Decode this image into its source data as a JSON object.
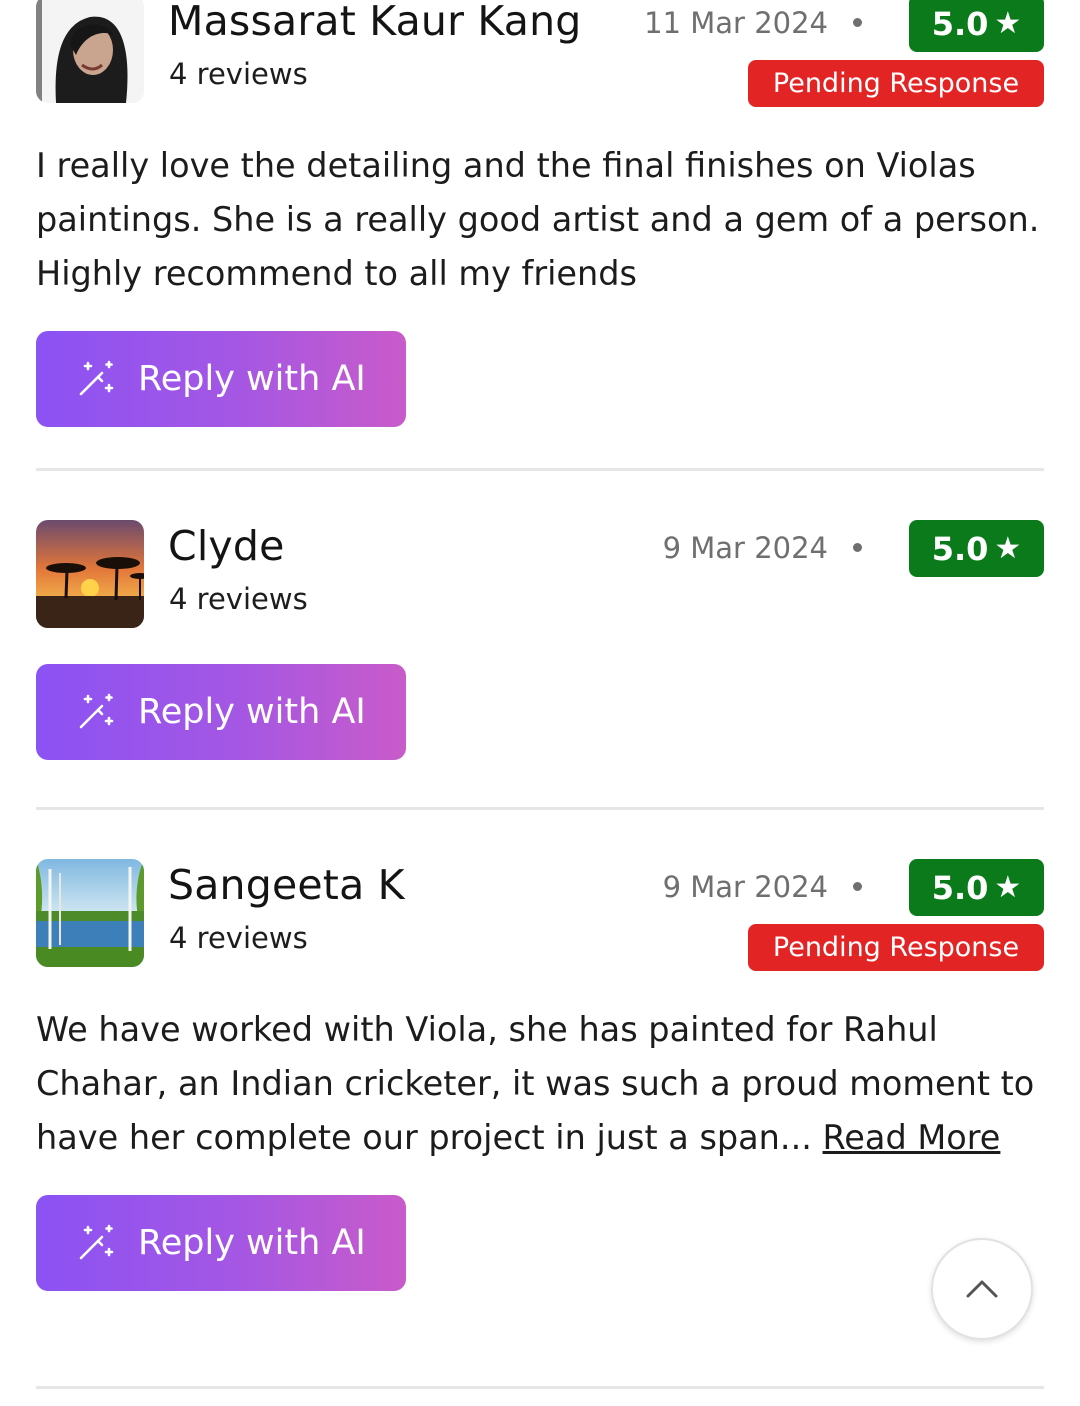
{
  "reviews": [
    {
      "name": "Massarat Kaur Kang",
      "review_count": "4 reviews",
      "date": "11 Mar 2024",
      "rating": "5.0",
      "status": "Pending Response",
      "text": "I really love the detailing and the final finishes on Violas paintings. She is a really good artist and a gem of a person. Highly recommend to all my friends",
      "button_label": "Reply with AI"
    },
    {
      "name": "Clyde",
      "review_count": "4 reviews",
      "date": "9 Mar 2024",
      "rating": "5.0",
      "button_label": "Reply with AI"
    },
    {
      "name": "Sangeeta K",
      "review_count": "4 reviews",
      "date": "9 Mar 2024",
      "rating": "5.0",
      "status": "Pending Response",
      "text": "We have worked with Viola, she has painted for Rahul Chahar, an Indian cricketer, it was such a proud moment to have her complete our project in just a span...",
      "read_more": "Read More",
      "button_label": "Reply with AI"
    }
  ],
  "icons": {
    "star": "★",
    "ai_button": "magic-wand-icon",
    "scroll_top": "chevron-up-icon"
  },
  "colors": {
    "rating_badge": "#0b7a1a",
    "status_badge": "#e32424",
    "button_gradient_start": "#8b52f4",
    "button_gradient_end": "#c95bca"
  }
}
